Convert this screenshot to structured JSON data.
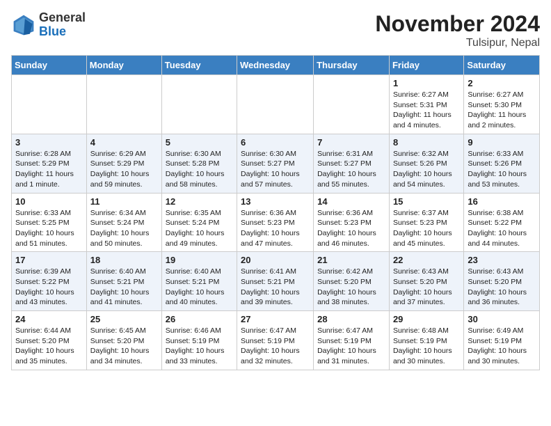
{
  "header": {
    "logo": {
      "general": "General",
      "blue": "Blue"
    },
    "month_title": "November 2024",
    "subtitle": "Tulsipur, Nepal"
  },
  "weekdays": [
    "Sunday",
    "Monday",
    "Tuesday",
    "Wednesday",
    "Thursday",
    "Friday",
    "Saturday"
  ],
  "weeks": [
    [
      {
        "day": "",
        "info": ""
      },
      {
        "day": "",
        "info": ""
      },
      {
        "day": "",
        "info": ""
      },
      {
        "day": "",
        "info": ""
      },
      {
        "day": "",
        "info": ""
      },
      {
        "day": "1",
        "info": "Sunrise: 6:27 AM\nSunset: 5:31 PM\nDaylight: 11 hours and 4 minutes."
      },
      {
        "day": "2",
        "info": "Sunrise: 6:27 AM\nSunset: 5:30 PM\nDaylight: 11 hours and 2 minutes."
      }
    ],
    [
      {
        "day": "3",
        "info": "Sunrise: 6:28 AM\nSunset: 5:29 PM\nDaylight: 11 hours and 1 minute."
      },
      {
        "day": "4",
        "info": "Sunrise: 6:29 AM\nSunset: 5:29 PM\nDaylight: 10 hours and 59 minutes."
      },
      {
        "day": "5",
        "info": "Sunrise: 6:30 AM\nSunset: 5:28 PM\nDaylight: 10 hours and 58 minutes."
      },
      {
        "day": "6",
        "info": "Sunrise: 6:30 AM\nSunset: 5:27 PM\nDaylight: 10 hours and 57 minutes."
      },
      {
        "day": "7",
        "info": "Sunrise: 6:31 AM\nSunset: 5:27 PM\nDaylight: 10 hours and 55 minutes."
      },
      {
        "day": "8",
        "info": "Sunrise: 6:32 AM\nSunset: 5:26 PM\nDaylight: 10 hours and 54 minutes."
      },
      {
        "day": "9",
        "info": "Sunrise: 6:33 AM\nSunset: 5:26 PM\nDaylight: 10 hours and 53 minutes."
      }
    ],
    [
      {
        "day": "10",
        "info": "Sunrise: 6:33 AM\nSunset: 5:25 PM\nDaylight: 10 hours and 51 minutes."
      },
      {
        "day": "11",
        "info": "Sunrise: 6:34 AM\nSunset: 5:24 PM\nDaylight: 10 hours and 50 minutes."
      },
      {
        "day": "12",
        "info": "Sunrise: 6:35 AM\nSunset: 5:24 PM\nDaylight: 10 hours and 49 minutes."
      },
      {
        "day": "13",
        "info": "Sunrise: 6:36 AM\nSunset: 5:23 PM\nDaylight: 10 hours and 47 minutes."
      },
      {
        "day": "14",
        "info": "Sunrise: 6:36 AM\nSunset: 5:23 PM\nDaylight: 10 hours and 46 minutes."
      },
      {
        "day": "15",
        "info": "Sunrise: 6:37 AM\nSunset: 5:23 PM\nDaylight: 10 hours and 45 minutes."
      },
      {
        "day": "16",
        "info": "Sunrise: 6:38 AM\nSunset: 5:22 PM\nDaylight: 10 hours and 44 minutes."
      }
    ],
    [
      {
        "day": "17",
        "info": "Sunrise: 6:39 AM\nSunset: 5:22 PM\nDaylight: 10 hours and 43 minutes."
      },
      {
        "day": "18",
        "info": "Sunrise: 6:40 AM\nSunset: 5:21 PM\nDaylight: 10 hours and 41 minutes."
      },
      {
        "day": "19",
        "info": "Sunrise: 6:40 AM\nSunset: 5:21 PM\nDaylight: 10 hours and 40 minutes."
      },
      {
        "day": "20",
        "info": "Sunrise: 6:41 AM\nSunset: 5:21 PM\nDaylight: 10 hours and 39 minutes."
      },
      {
        "day": "21",
        "info": "Sunrise: 6:42 AM\nSunset: 5:20 PM\nDaylight: 10 hours and 38 minutes."
      },
      {
        "day": "22",
        "info": "Sunrise: 6:43 AM\nSunset: 5:20 PM\nDaylight: 10 hours and 37 minutes."
      },
      {
        "day": "23",
        "info": "Sunrise: 6:43 AM\nSunset: 5:20 PM\nDaylight: 10 hours and 36 minutes."
      }
    ],
    [
      {
        "day": "24",
        "info": "Sunrise: 6:44 AM\nSunset: 5:20 PM\nDaylight: 10 hours and 35 minutes."
      },
      {
        "day": "25",
        "info": "Sunrise: 6:45 AM\nSunset: 5:20 PM\nDaylight: 10 hours and 34 minutes."
      },
      {
        "day": "26",
        "info": "Sunrise: 6:46 AM\nSunset: 5:19 PM\nDaylight: 10 hours and 33 minutes."
      },
      {
        "day": "27",
        "info": "Sunrise: 6:47 AM\nSunset: 5:19 PM\nDaylight: 10 hours and 32 minutes."
      },
      {
        "day": "28",
        "info": "Sunrise: 6:47 AM\nSunset: 5:19 PM\nDaylight: 10 hours and 31 minutes."
      },
      {
        "day": "29",
        "info": "Sunrise: 6:48 AM\nSunset: 5:19 PM\nDaylight: 10 hours and 30 minutes."
      },
      {
        "day": "30",
        "info": "Sunrise: 6:49 AM\nSunset: 5:19 PM\nDaylight: 10 hours and 30 minutes."
      }
    ]
  ]
}
